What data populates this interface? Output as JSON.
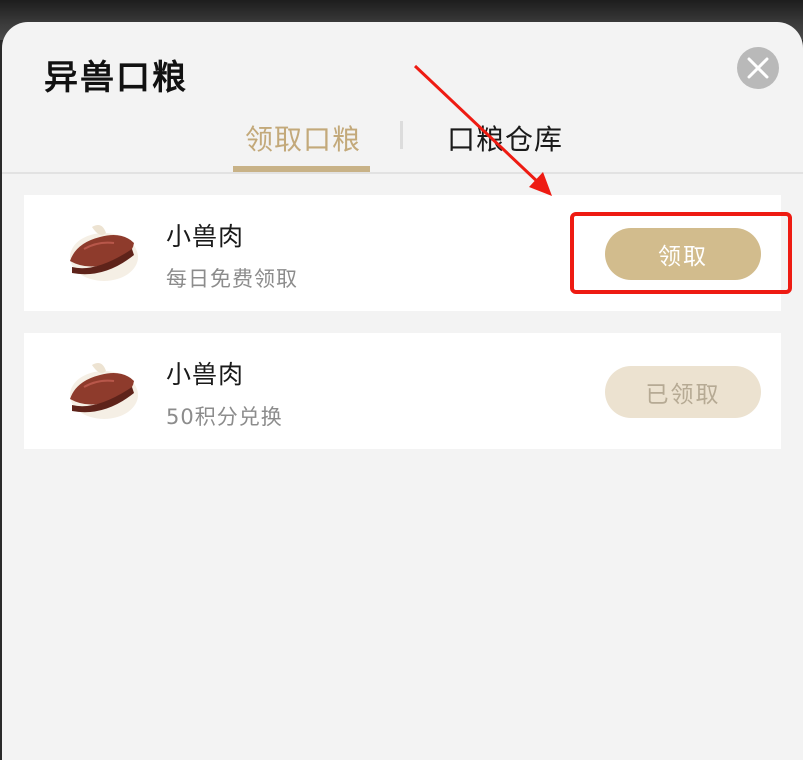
{
  "dialog": {
    "title": "异兽口粮"
  },
  "tabs": [
    {
      "label": "领取口粮",
      "active": true
    },
    {
      "label": "口粮仓库",
      "active": false
    }
  ],
  "items": [
    {
      "name": "小兽肉",
      "desc": "每日免费领取",
      "button": "领取",
      "state": "available"
    },
    {
      "name": "小兽肉",
      "desc": "50积分兑换",
      "button": "已领取",
      "state": "claimed"
    }
  ],
  "icons": {
    "close": "close-icon",
    "item": "meat-icon"
  },
  "colors": {
    "accent_gold": "#c8b287",
    "button_active": "#d2bc8d",
    "button_done": "#ece2d0",
    "annotation_red": "#ee1b12"
  }
}
